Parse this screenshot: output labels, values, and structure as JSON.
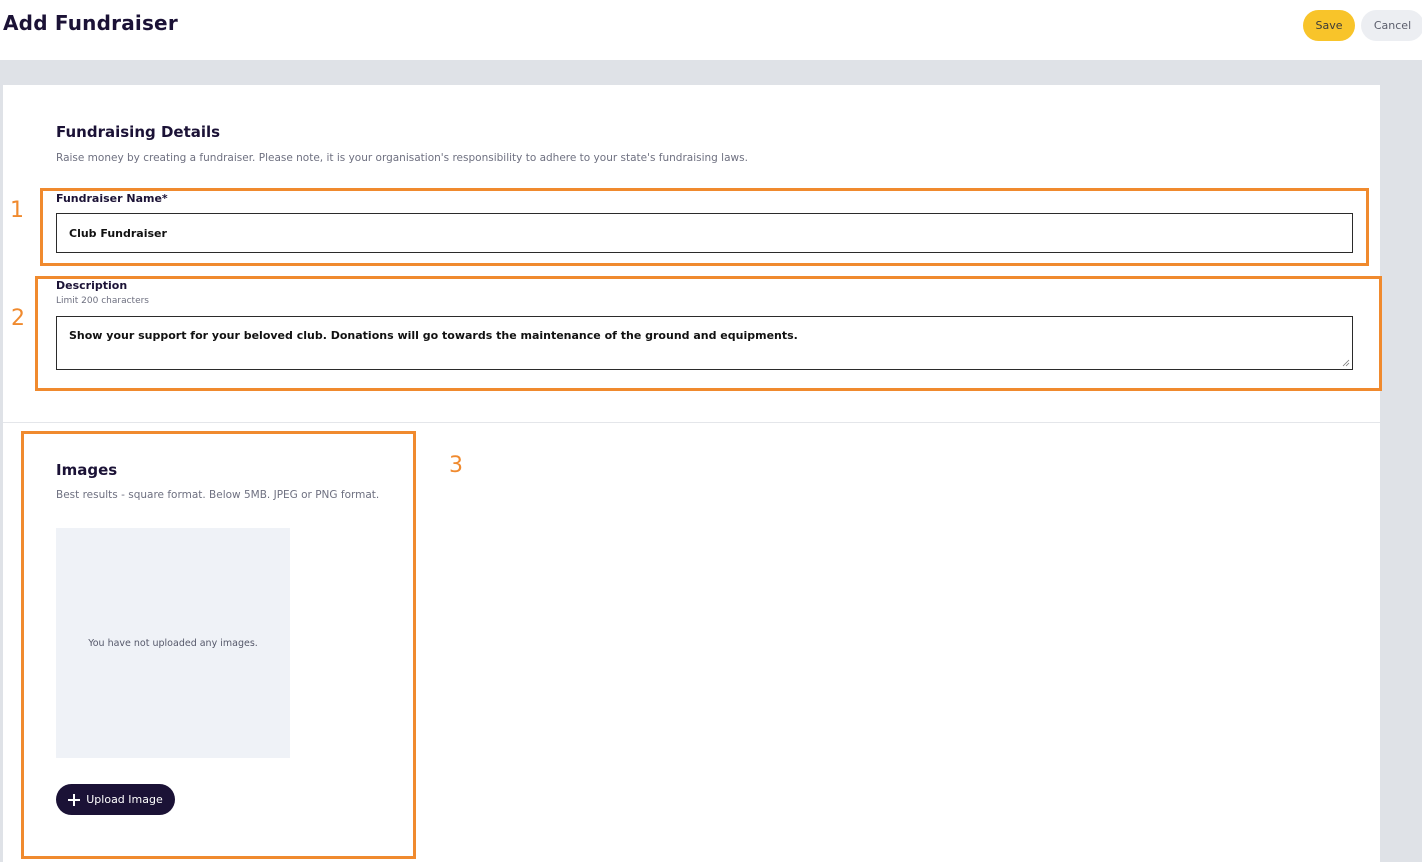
{
  "header": {
    "title": "Add Fundraiser",
    "save_label": "Save",
    "cancel_label": "Cancel"
  },
  "details": {
    "title": "Fundraising Details",
    "description": "Raise money by creating a fundraiser. Please note, it is your organisation's responsibility to adhere to your state's fundraising laws.",
    "name_label": "Fundraiser Name*",
    "name_value": "Club Fundraiser",
    "description_label": "Description",
    "description_hint": "Limit 200 characters",
    "description_value": "Show your support for your beloved club. Donations will go towards the maintenance of the ground and equipments."
  },
  "images": {
    "title": "Images",
    "description": "Best results - square format. Below 5MB. JPEG or PNG format.",
    "empty_text": "You have not uploaded any images.",
    "upload_label": "Upload Image"
  },
  "annotations": {
    "one": "1",
    "two": "2",
    "three": "3"
  },
  "colors": {
    "accent": "#f8c42a",
    "primary": "#1b1236",
    "annotation": "#f08a2e"
  }
}
